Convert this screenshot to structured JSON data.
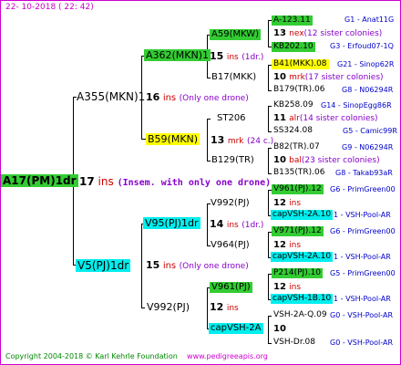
{
  "header": {
    "date": "22- 10-2018 ( 22: 42)"
  },
  "footer": {
    "copyright": "Copyright 2004-2018 © Karl Kehrle Foundation",
    "site": "www.pedigreeapis.org"
  },
  "root": {
    "name": "A17(PM)1dr",
    "ins": "17",
    "ins_label": "ins",
    "note": "(Insem. with only one drone)"
  },
  "gen1": {
    "top": {
      "name": "A355(MKN)1",
      "ins": "16",
      "ins_label": "ins",
      "note": "(Only one drone)"
    },
    "bottom": {
      "name": "V5(PJ)1dr",
      "ins": "15",
      "ins_label": "ins",
      "note": "(Only one drone)"
    }
  },
  "gen2": {
    "a": {
      "name": "A362(MKN)1",
      "ins": "15",
      "ins_label": "ins",
      "note": "(1dr.)"
    },
    "b": {
      "name": "B59(MKN)",
      "ins": "13",
      "ins_label": "mrk",
      "note": "(24 c.)"
    },
    "c": {
      "name": "V95(PJ)1dr",
      "ins": "14",
      "ins_label": "ins",
      "note": "(1dr.)"
    },
    "d": {
      "name": "V992(PJ)",
      "ins": "12",
      "ins_label": "ins"
    }
  },
  "gen3": [
    {
      "name": "A59(MKW)",
      "ins": "13",
      "ins_label": "nex",
      "note": "(12 sister colonies)"
    },
    {
      "name": "B17(MKK)",
      "ins": "10",
      "ins_label": "mrk",
      "note": "(17 sister colonies)"
    },
    {
      "name": "ST206",
      "ins": "11",
      "ins_label": "alr",
      "note": "(14 sister colonies)"
    },
    {
      "name": "B129(TR)",
      "ins": "10",
      "ins_label": "bal",
      "note": "(23 sister colonies)"
    },
    {
      "name": "V992(PJ)",
      "ins": "12",
      "ins_label": "ins"
    },
    {
      "name": "V964(PJ)",
      "ins": "12",
      "ins_label": "ins"
    },
    {
      "name": "V961(PJ)",
      "ins": "12",
      "ins_label": "ins"
    },
    {
      "name": "capVSH-2A",
      "ins": "10",
      "ins_label": ""
    }
  ],
  "gen4": [
    {
      "name": "A-123.11",
      "info": "G1 - Anat11G"
    },
    {
      "name": "KB202.10",
      "info": "G3 - Erfoud07-1Q"
    },
    {
      "name": "B41(MKK).08",
      "info": "G21 - Sinop62R"
    },
    {
      "name": "B179(TR).06",
      "info": "G8 - N06294R"
    },
    {
      "name": "KB258.09",
      "info": "G14 - SinopEgg86R"
    },
    {
      "name": "SS324.08",
      "info": "G5 - Camic99R"
    },
    {
      "name": "B82(TR).07",
      "info": "G9 - N06294R"
    },
    {
      "name": "B135(TR).06",
      "info": "G8 - Takab93aR"
    },
    {
      "name": "V961(PJ).12",
      "info": "G6 - PrimGreen00"
    },
    {
      "name": "capVSH-2A.10",
      "info": "1 - VSH-Pool-AR"
    },
    {
      "name": "V971(PJ).12",
      "info": "G6 - PrimGreen00"
    },
    {
      "name": "capVSH-2A.10",
      "info": "1 - VSH-Pool-AR"
    },
    {
      "name": "P214(PJ).10",
      "info": "G5 - PrimGreen00"
    },
    {
      "name": "capVSH-1B.10",
      "info": "1 - VSH-Pool-AR"
    },
    {
      "name": "VSH-2A-Q.09",
      "info": "G0 - VSH-Pool-AR"
    },
    {
      "name": "VSH-Dr.08",
      "info": "G0 - VSH-Pool-AR"
    }
  ]
}
